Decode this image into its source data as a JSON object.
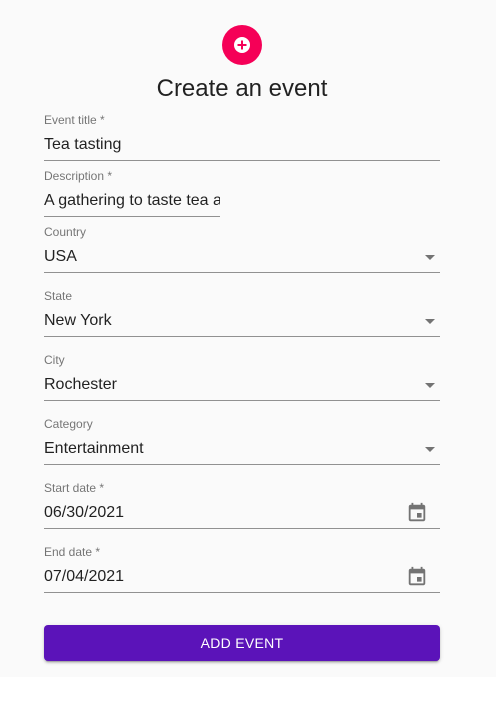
{
  "header": {
    "icon": "add-circle-icon",
    "title": "Create an event"
  },
  "form": {
    "event_title": {
      "label": "Event title *",
      "value": "Tea tasting"
    },
    "description": {
      "label": "Description *",
      "value": "A gathering to taste tea a"
    },
    "country": {
      "label": "Country",
      "value": "USA"
    },
    "state": {
      "label": "State",
      "value": "New York"
    },
    "city": {
      "label": "City",
      "value": "Rochester"
    },
    "category": {
      "label": "Category",
      "value": "Entertainment"
    },
    "start_date": {
      "label": "Start date *",
      "value": "06/30/2021"
    },
    "end_date": {
      "label": "End date *",
      "value": "07/04/2021"
    },
    "submit_label": "ADD EVENT"
  },
  "colors": {
    "avatar": "#f50057",
    "button": "#5b13b9",
    "page_background": "#fafafa"
  }
}
